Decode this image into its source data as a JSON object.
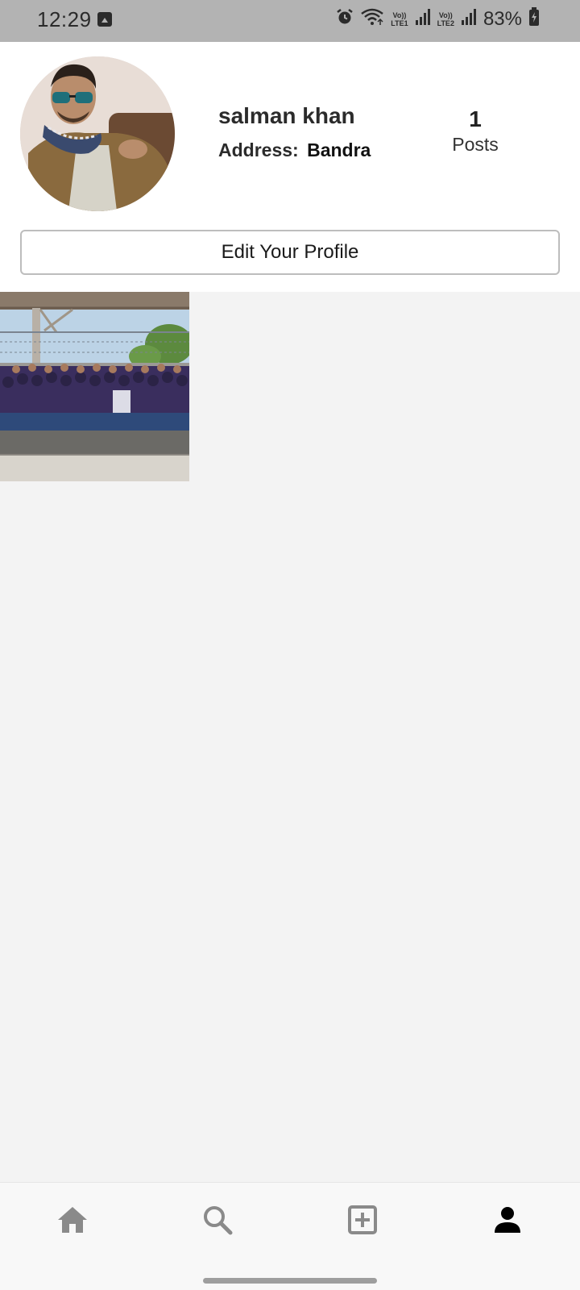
{
  "status_bar": {
    "time": "12:29",
    "battery_percent": "83%",
    "sim1_label_top": "Vo))",
    "sim1_label_bottom": "LTE1",
    "sim2_label_top": "Vo))",
    "sim2_label_bottom": "LTE2",
    "icons": [
      "gallery-icon",
      "alarm-icon",
      "wifi-icon",
      "signal-icon",
      "signal-icon",
      "battery-charging-icon"
    ]
  },
  "profile": {
    "username": "salman khan",
    "address_label": "Address:",
    "address_value": "Bandra",
    "posts_count": "1",
    "posts_label": "Posts",
    "edit_button_label": "Edit Your Profile"
  },
  "posts": [
    {
      "type": "group-photo"
    }
  ],
  "bottom_nav": {
    "items": [
      {
        "icon": "home-icon",
        "active": false
      },
      {
        "icon": "search-icon",
        "active": false
      },
      {
        "icon": "add-post-icon",
        "active": false
      },
      {
        "icon": "profile-icon",
        "active": true
      }
    ]
  },
  "colors": {
    "status_bar_bg": "#b3b3b3",
    "page_bg": "#f3f3f3",
    "header_bg": "#ffffff",
    "nav_inactive": "#8a8a8a",
    "nav_active": "#000000"
  }
}
